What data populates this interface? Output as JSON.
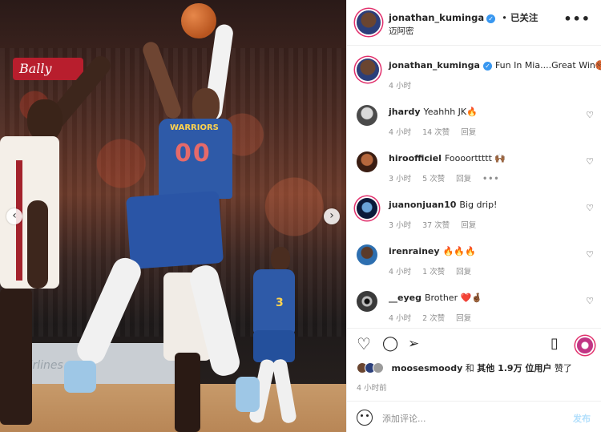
{
  "post_image": {
    "arena_sign": "Bally",
    "board_text": "airlines",
    "shooter_number": "00",
    "shooter_team": "WARRIORS",
    "teammate_number": "3",
    "prev_arrow": "‹",
    "next_arrow": "›"
  },
  "header": {
    "username": "jonathan_kuminga",
    "verified_mark": "✓",
    "separator": "•",
    "follow_label": "已关注",
    "location": "迈阿密",
    "more_label": "•••"
  },
  "caption": {
    "username": "jonathan_kuminga",
    "text": "Fun In Mia....Great Win🏀",
    "time": "4 小时"
  },
  "comments": [
    {
      "username": "jhardy",
      "text": "Yeahhh JK🔥",
      "time": "4 小时",
      "likes": "14 次赞",
      "reply": "回复",
      "extra": ""
    },
    {
      "username": "hiroofficiel",
      "text": "Foooorttttt 🙌🏾",
      "time": "3 小时",
      "likes": "5 次赞",
      "reply": "回复",
      "extra": "•••"
    },
    {
      "username": "juanonjuan10",
      "text": "Big drip!",
      "time": "3 小时",
      "likes": "37 次赞",
      "reply": "回复",
      "extra": ""
    },
    {
      "username": "irenrainey",
      "text": "🔥🔥🔥",
      "time": "4 小时",
      "likes": "1 次赞",
      "reply": "回复",
      "extra": ""
    },
    {
      "username": "__eyeg",
      "text": "Brother ❤️🤞🏾",
      "time": "4 小时",
      "likes": "2 次赞",
      "reply": "回复",
      "extra": ""
    }
  ],
  "icons": {
    "like": "♡",
    "comment": "◯",
    "share": "➢",
    "save": "▯",
    "comment_like": "♡"
  },
  "likes": {
    "first_user": "moosesmoody",
    "connector": "和",
    "others": "其他 1.9万 位用户",
    "suffix": "赞了"
  },
  "posted_ago": "4 小时前",
  "add_comment": {
    "placeholder": "添加评论...",
    "post_label": "发布"
  },
  "colors": {
    "verified": "#3897f0",
    "story_ring": "#e1306c",
    "post_button": "#b2dffc",
    "warriors_blue": "#2e5aa8",
    "heat_red": "#a3222c"
  }
}
